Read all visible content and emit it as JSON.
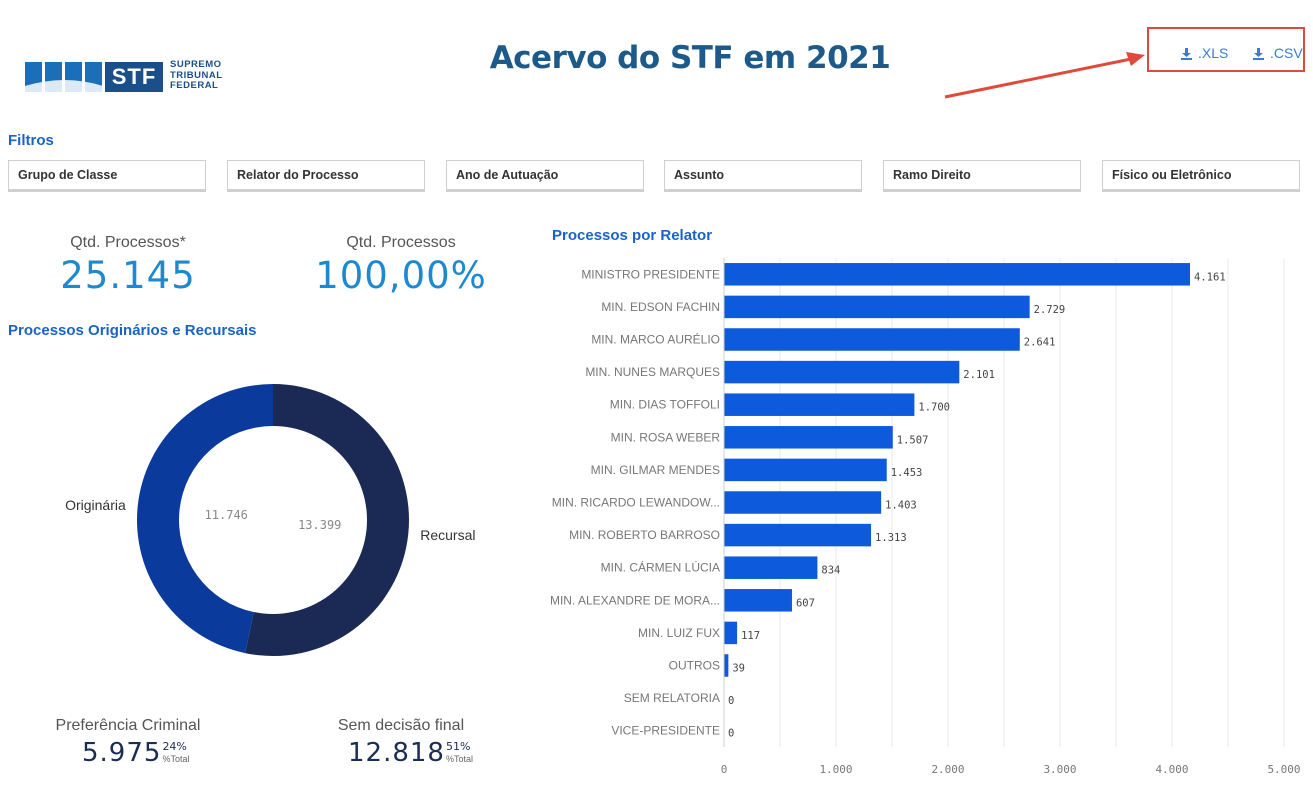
{
  "logo": {
    "abbr": "STF",
    "line1": "SUPREMO",
    "line2": "TRIBUNAL",
    "line3": "FEDERAL"
  },
  "title": "Acervo do STF em 2021",
  "export": {
    "xls_label": ".XLS",
    "csv_label": ".CSV",
    "highlight_color": "#e04a3a"
  },
  "filters": {
    "title": "Filtros",
    "items": [
      "Grupo de Classe",
      "Relator do Processo",
      "Ano de Autuação",
      "Assunto",
      "Ramo Direito",
      "Físico ou Eletrônico"
    ]
  },
  "kpis": {
    "qtd_label": "Qtd. Processos*",
    "qtd_value": "25.145",
    "pct_label": "Qtd. Processos",
    "pct_value": "100,00%"
  },
  "bottom_kpis": {
    "pref_label": "Preferência Criminal",
    "pref_value": "5.975",
    "pref_pct": "24%",
    "pref_sub": "%Total",
    "sem_label": "Sem decisão final",
    "sem_value": "12.818",
    "sem_pct": "51%",
    "sem_sub": "%Total"
  },
  "chart_data": [
    {
      "type": "pie",
      "title": "Processos Originários e Recursais",
      "categories": [
        "Originária",
        "Recursal"
      ],
      "values": [
        11746,
        13399
      ],
      "value_labels": [
        "11.746",
        "13.399"
      ],
      "colors": [
        "#0a3a9c",
        "#1a2a55"
      ]
    },
    {
      "type": "bar",
      "orientation": "horizontal",
      "title": "Processos por Relator",
      "categories": [
        "MINISTRO PRESIDENTE",
        "MIN. EDSON FACHIN",
        "MIN. MARCO AURÉLIO",
        "MIN. NUNES MARQUES",
        "MIN. DIAS TOFFOLI",
        "MIN. ROSA WEBER",
        "MIN. GILMAR MENDES",
        "MIN. RICARDO LEWANDOW...",
        "MIN. ROBERTO BARROSO",
        "MIN. CÁRMEN LÚCIA",
        "MIN. ALEXANDRE DE MORA...",
        "MIN. LUIZ FUX",
        "OUTROS",
        "SEM RELATORIA",
        "VICE-PRESIDENTE"
      ],
      "values": [
        4161,
        2729,
        2641,
        2101,
        1700,
        1507,
        1453,
        1403,
        1313,
        834,
        607,
        117,
        39,
        0,
        0
      ],
      "value_labels": [
        "4.161",
        "2.729",
        "2.641",
        "2.101",
        "1.700",
        "1.507",
        "1.453",
        "1.403",
        "1.313",
        "834",
        "607",
        "117",
        "39",
        "0",
        "0"
      ],
      "xlim": [
        0,
        5000
      ],
      "xticks": [
        0,
        1000,
        2000,
        3000,
        4000,
        5000
      ],
      "xtick_labels": [
        "0",
        "1.000",
        "2.000",
        "3.000",
        "4.000",
        "5.000"
      ],
      "grid": true,
      "color": "#0d5bdc"
    }
  ]
}
